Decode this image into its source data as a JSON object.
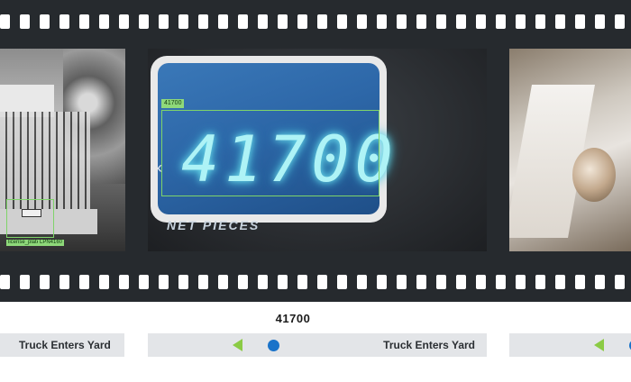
{
  "frames": {
    "left": {
      "plate_tag": "license_plate",
      "plate_value": "LPN4160"
    },
    "center": {
      "detection_tag": "41700",
      "display_digits": "41700",
      "display_caption": "NET PIECES",
      "prev_icon": "chevron-left-icon"
    },
    "right": {}
  },
  "caption": "41700",
  "timeline": {
    "left_label": "Truck Enters Yard",
    "center_label": "Truck Enters Yard",
    "marker_color": "#8bcb45",
    "dot_color": "#1a73c9"
  },
  "colors": {
    "film": "#262a2e",
    "detection_box": "#7fd46a",
    "bar": "#e3e5e8"
  }
}
